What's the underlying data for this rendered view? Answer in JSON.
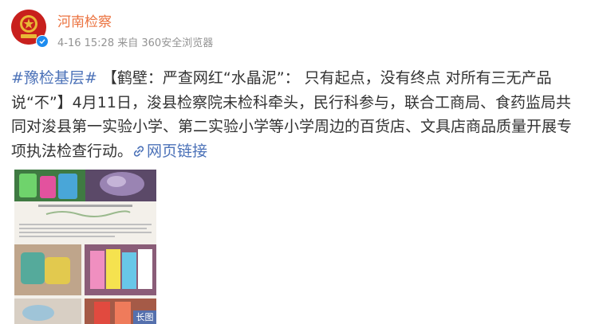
{
  "author": {
    "name": "河南检察",
    "avatar_text": "河南检察"
  },
  "meta": {
    "timestamp": "4-16 15:28",
    "source": "来自 360安全浏览器"
  },
  "post": {
    "hashtag": "#豫检基层#",
    "text": " 【鹤壁：严查网红“水晶泥”： 只有起点，没有终点 对所有三无产品说“不”】4月11日，浚县检察院未检科牵头，民行科参与，联合工商局、食药监局共同对浚县第一实验小学、第二实验小学等小学周边的百货店、文具店商品质量开展专项执法检查行动。",
    "link_label": "网页链接"
  },
  "image": {
    "badge": "长图"
  },
  "colors": {
    "author": "#eb7340",
    "link": "#4c72b8",
    "meta": "#939393",
    "avatar": "#c8201d"
  }
}
